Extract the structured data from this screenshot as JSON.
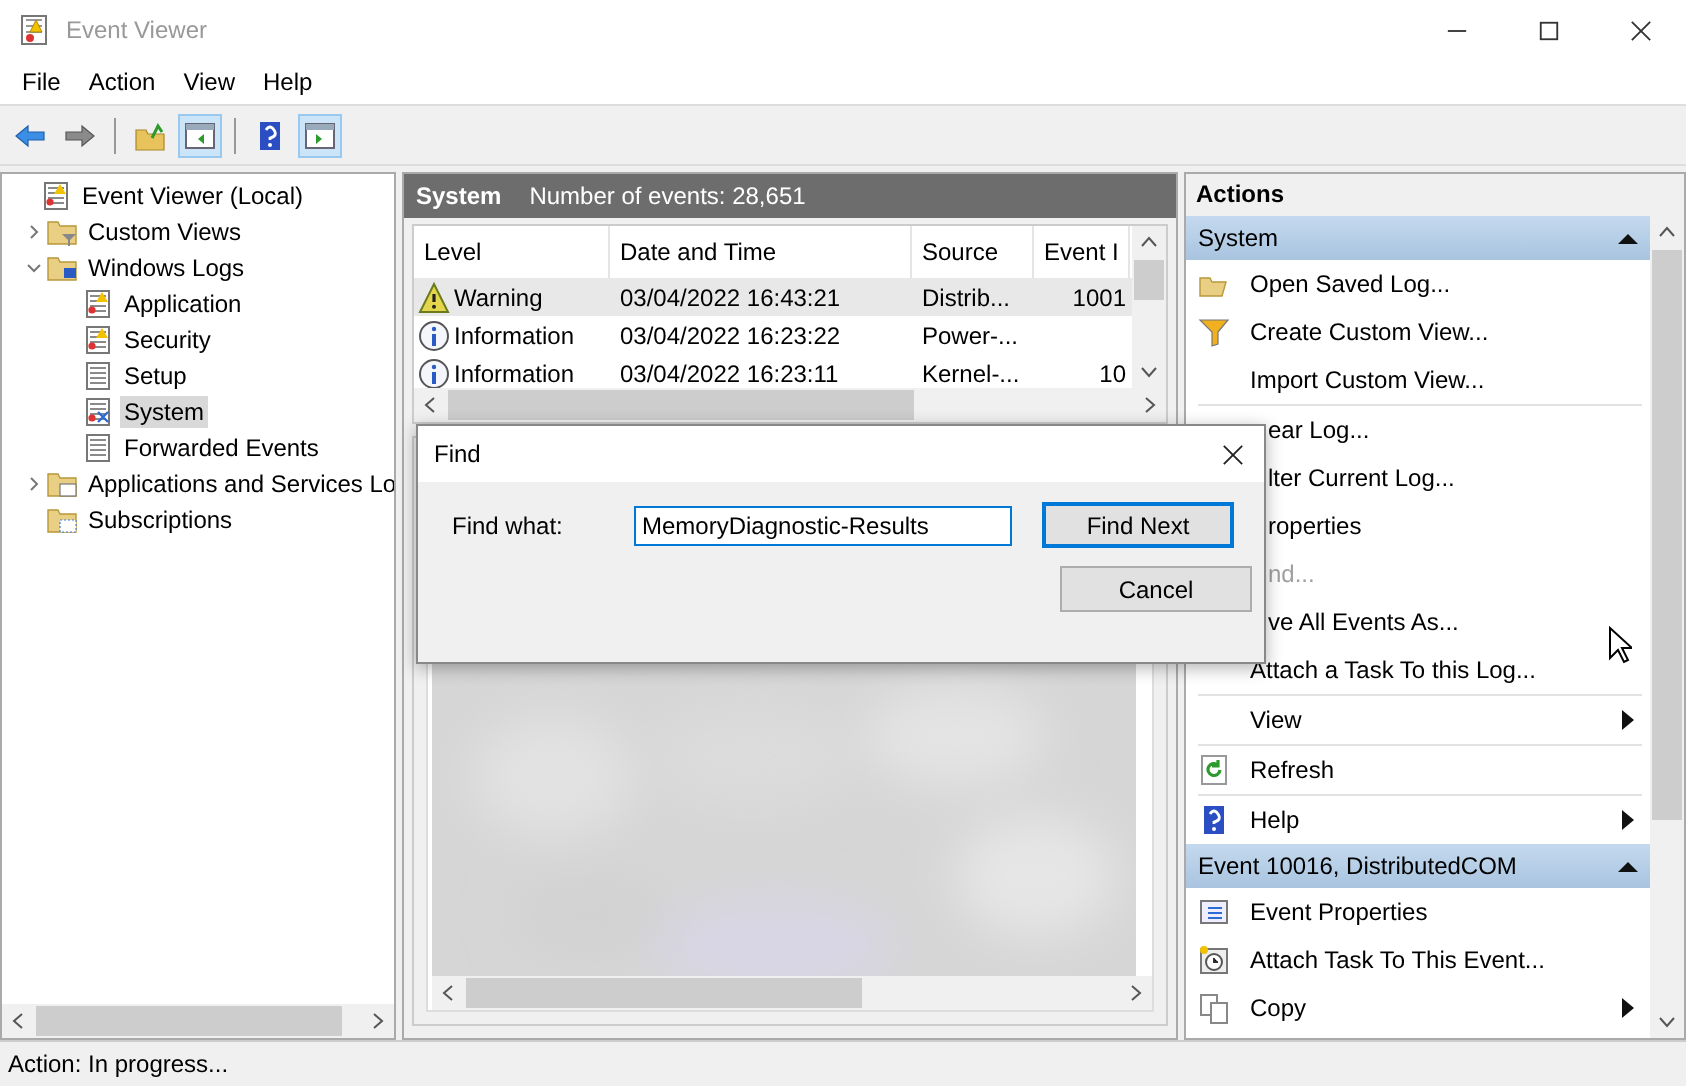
{
  "window": {
    "title": "Event Viewer"
  },
  "menu": [
    "File",
    "Action",
    "View",
    "Help"
  ],
  "toolbar": [
    {
      "pressed": false
    },
    {
      "pressed": false
    },
    {
      "pressed": false
    },
    {
      "pressed": true
    },
    {
      "pressed": false
    },
    {
      "pressed": true
    }
  ],
  "tree": [
    {
      "label": "Event Viewer (Local)",
      "selected": false,
      "children": [
        {
          "label": "Custom Views",
          "selected": false,
          "expanded": false
        },
        {
          "label": "Windows Logs",
          "selected": false,
          "expanded": true,
          "children": [
            {
              "label": "Application",
              "selected": false
            },
            {
              "label": "Security",
              "selected": false
            },
            {
              "label": "Setup",
              "selected": false
            },
            {
              "label": "System",
              "selected": true
            },
            {
              "label": "Forwarded Events",
              "selected": false
            }
          ]
        },
        {
          "label": "Applications and Services Lo",
          "selected": false,
          "expanded": false
        },
        {
          "label": "Subscriptions",
          "selected": false
        }
      ]
    }
  ],
  "log_header": {
    "name": "System",
    "count": "Number of events: 28,651"
  },
  "table": {
    "columns": [
      "Level",
      "Date and Time",
      "Source",
      "Event I"
    ],
    "rows": [
      {
        "kind": "warning",
        "level": "Warning",
        "date": "03/04/2022 16:43:21",
        "source": "Distrib...",
        "event_id": "1001",
        "selected": true
      },
      {
        "kind": "info",
        "level": "Information",
        "date": "03/04/2022 16:23:22",
        "source": "Power-...",
        "selected": false
      },
      {
        "kind": "info",
        "level": "Information",
        "date": "03/04/2022 16:23:11",
        "source": "Kernel-...",
        "event_id": "10",
        "selected": false
      }
    ]
  },
  "details": {
    "kind": "picture"
  },
  "find_dialog": {
    "title": "Find",
    "label": "Find what:",
    "value": "MemoryDiagnostic-Results",
    "buttons": [
      "Find Next",
      "Cancel"
    ]
  },
  "actions": {
    "title": "Actions",
    "sections": [
      {
        "title": "System",
        "items": [
          {
            "label": "Open Saved Log..."
          },
          {
            "label": "Create Custom View..."
          },
          {
            "label": "Import Custom View...",
            "divider": true
          },
          {
            "label": "ear Log...",
            "covered": true
          },
          {
            "label": "lter Current Log...",
            "covered": true
          },
          {
            "label": "roperties",
            "covered": true
          },
          {
            "label": "nd...",
            "covered": true,
            "disabled": true
          },
          {
            "label": "ve All Events As...",
            "covered": true
          },
          {
            "label": "Attach a Task To this Log...",
            "divider": true
          },
          {
            "label": "View",
            "submenu": true,
            "divider": true
          },
          {
            "label": "Refresh",
            "divider": true
          },
          {
            "label": "Help",
            "submenu": true
          }
        ]
      },
      {
        "title": "Event 10016, DistributedCOM",
        "items": [
          {
            "label": "Event Properties"
          },
          {
            "label": "Attach Task To This Event..."
          },
          {
            "label": "Copy",
            "submenu": true
          }
        ]
      }
    ]
  },
  "status_bar": "Action:  In progress..."
}
